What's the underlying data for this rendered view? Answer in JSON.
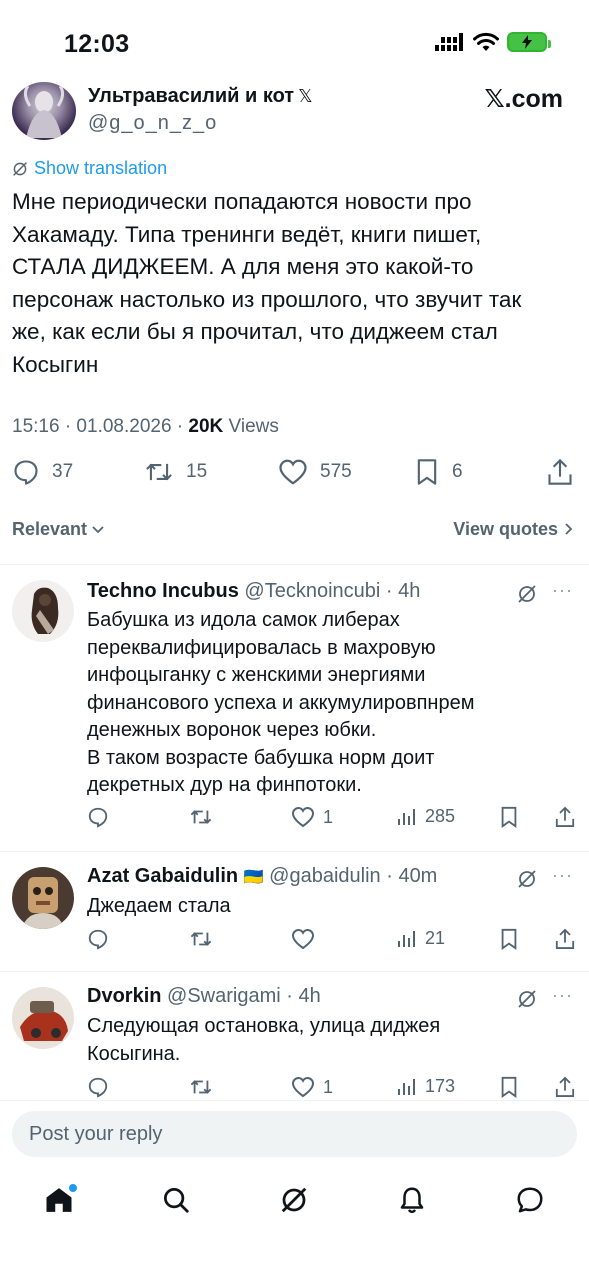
{
  "status_bar": {
    "time": "12:03"
  },
  "tweet": {
    "author_name": "Ультравасилий и кот",
    "author_badge": "𝕏",
    "author_handle": "@g_o_n_z_o",
    "brand": "𝕏.com",
    "show_translation": "Show translation",
    "text": "Мне периодически попадаются новости про\nХакамаду. Типа тренинги ведёт, книги пишет,\nСТАЛА ДИДЖЕЕМ. А для меня это какой-то\nперсонаж настолько из прошлого, что звучит так\nже, как если бы я прочитал, что диджеем стал\nКосыгин",
    "timestamp": "15:16 · 01.08.2026 · ",
    "views_count": "20K",
    "views_label": " Views",
    "stats": {
      "replies": "37",
      "reposts": "15",
      "likes": "575",
      "bookmarks": "6"
    }
  },
  "filter": {
    "sort_label": "Relevant",
    "quotes_label": "View quotes"
  },
  "replies": [
    {
      "name": "Techno Incubus",
      "handle": "@Tecknoincubi · 4h",
      "text": "Бабушка из идола самок либерах\nпереквалифицировалась в махровую\nинфоцыганку с женскими энергиями\nфинансового успеха и аккумулировпнрем\nденежных воронок через юбки.\nВ таком возрасте бабушка норм доит\nдекретных дур на финпотоки.",
      "likes": "1",
      "views": "285"
    },
    {
      "name": "Azat Gabaidulin",
      "flag": "🇺🇦",
      "handle": "@gabaidulin · 40m",
      "text": "Джедаем стала",
      "likes": "",
      "views": "21"
    },
    {
      "name": "Dvorkin",
      "handle": "@Swarigami · 4h",
      "text": "Следующая остановка, улица диджея\nКосыгина.",
      "likes": "1",
      "views": "173"
    }
  ],
  "composer": {
    "placeholder": "Post your reply"
  },
  "colors": {
    "accent": "#1d9bf0",
    "muted": "#536471",
    "text": "#0f1419"
  }
}
